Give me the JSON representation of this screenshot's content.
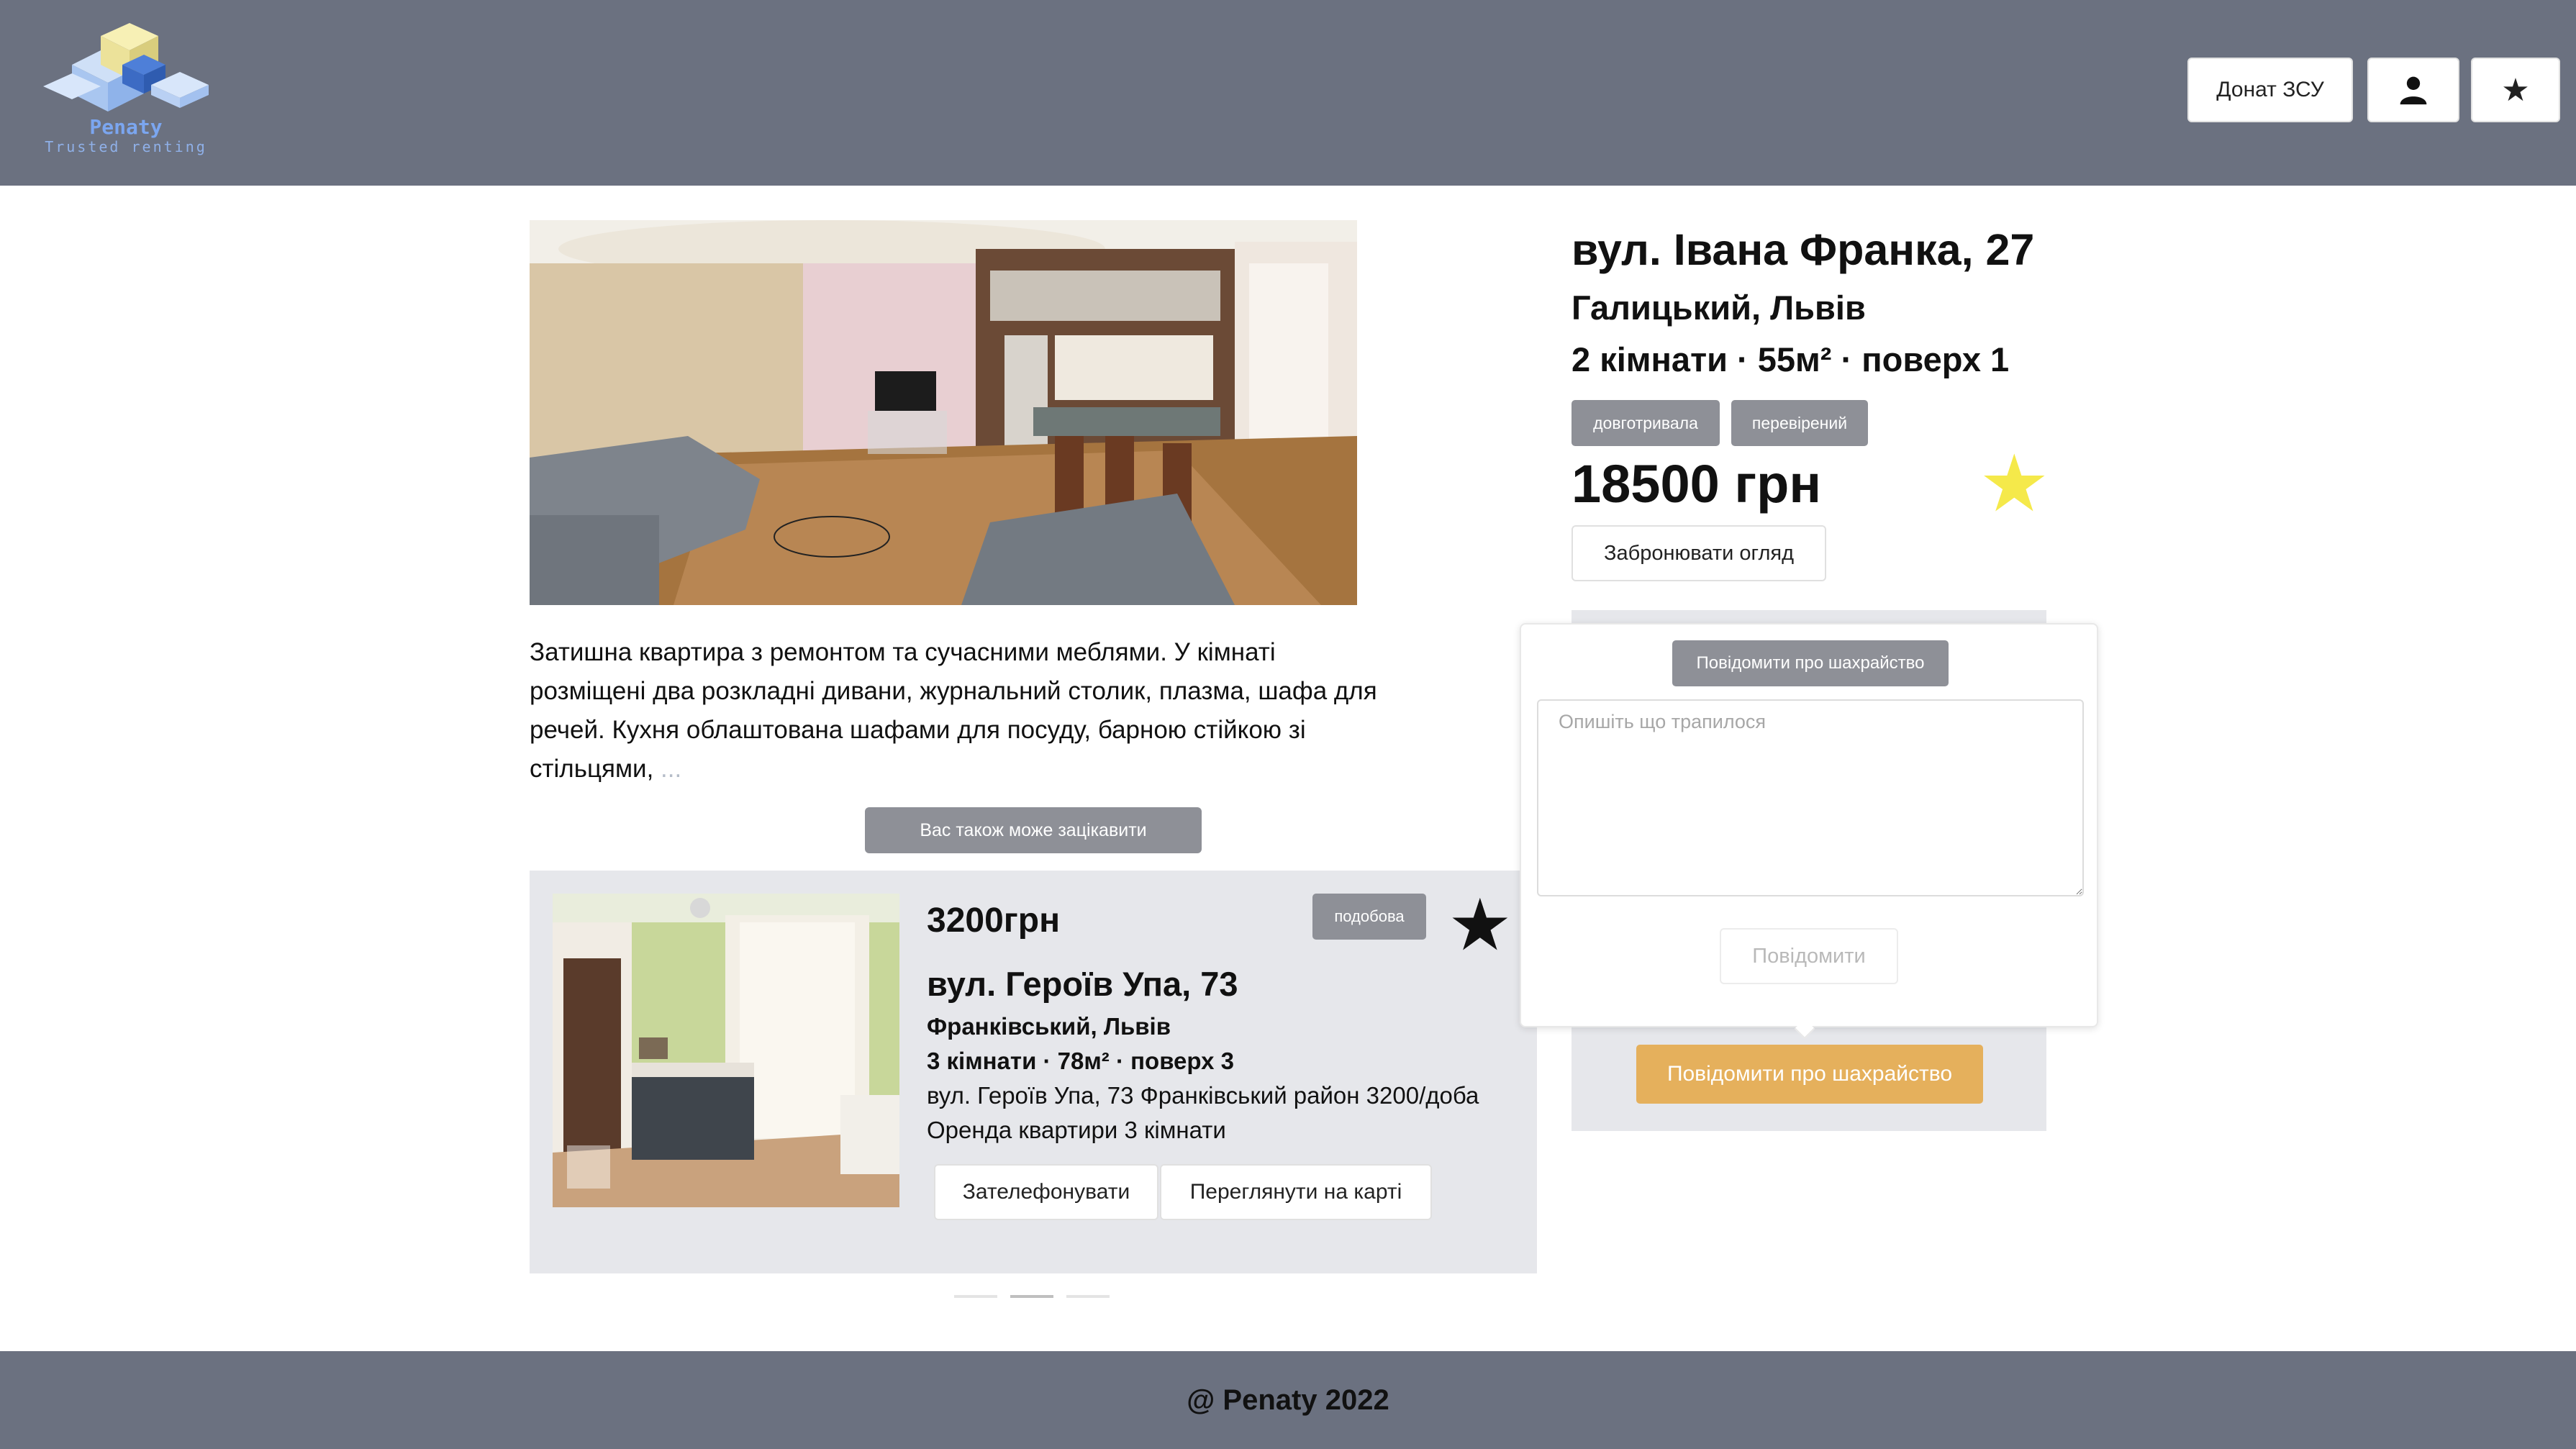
{
  "header": {
    "logo_name": "Penaty",
    "logo_tagline": "Trusted renting",
    "donate_label": "Донат ЗСУ",
    "user_icon": "user-icon",
    "favorites_icon": "star-icon",
    "favorites_glyph": "★"
  },
  "listing": {
    "description": "Затишна квартира з ремонтом та сучасними меблями. У кімнаті розміщені два розкладні дивани, журнальний столик, плазма, шафа для речей. Кухня облаштована шафами для посуду, барною стійкою зі стільцями,",
    "more": "...",
    "title": "вул. Івана Франка, 27",
    "district": "Галицький, Львів",
    "rooms_line": "2 кімнати · 55м² · поверх 1",
    "tags": [
      "довготривала",
      "перевірений"
    ],
    "price": "18500 грн",
    "favorite_glyph": "★",
    "favorite_color": "#f5e94a",
    "book_label": "Забронювати огляд",
    "fraud_label": "Повідомити про шахрайство",
    "fraud_color": "#e5b05c"
  },
  "suggestions": {
    "heading": "Вас також може зацікавити",
    "card": {
      "price": "3200грн",
      "badge": "подобова",
      "favorite_glyph": "★",
      "street": "вул. Героїв Упа, 73",
      "district": "Франківський, Львів",
      "rooms_line": "3 кімнати · 78м² · поверх 3",
      "line1": "вул. Героїв Упа, 73 Франківський район 3200/доба",
      "line2": "Оренда квартири 3 кімнати",
      "call_label": "Зателефонувати",
      "map_label": "Переглянути на карті"
    },
    "carousel_active_index": 1
  },
  "report_popover": {
    "heading": "Повідомити про шахрайство",
    "placeholder": "Опишіть що трапилося",
    "value": "",
    "submit_label": "Повідомити"
  },
  "footer": {
    "text": "@ Penaty 2022"
  },
  "colors": {
    "header_bg": "#6b7180",
    "panel_bg": "#e6e7eb",
    "badge_bg": "#8e9097"
  }
}
